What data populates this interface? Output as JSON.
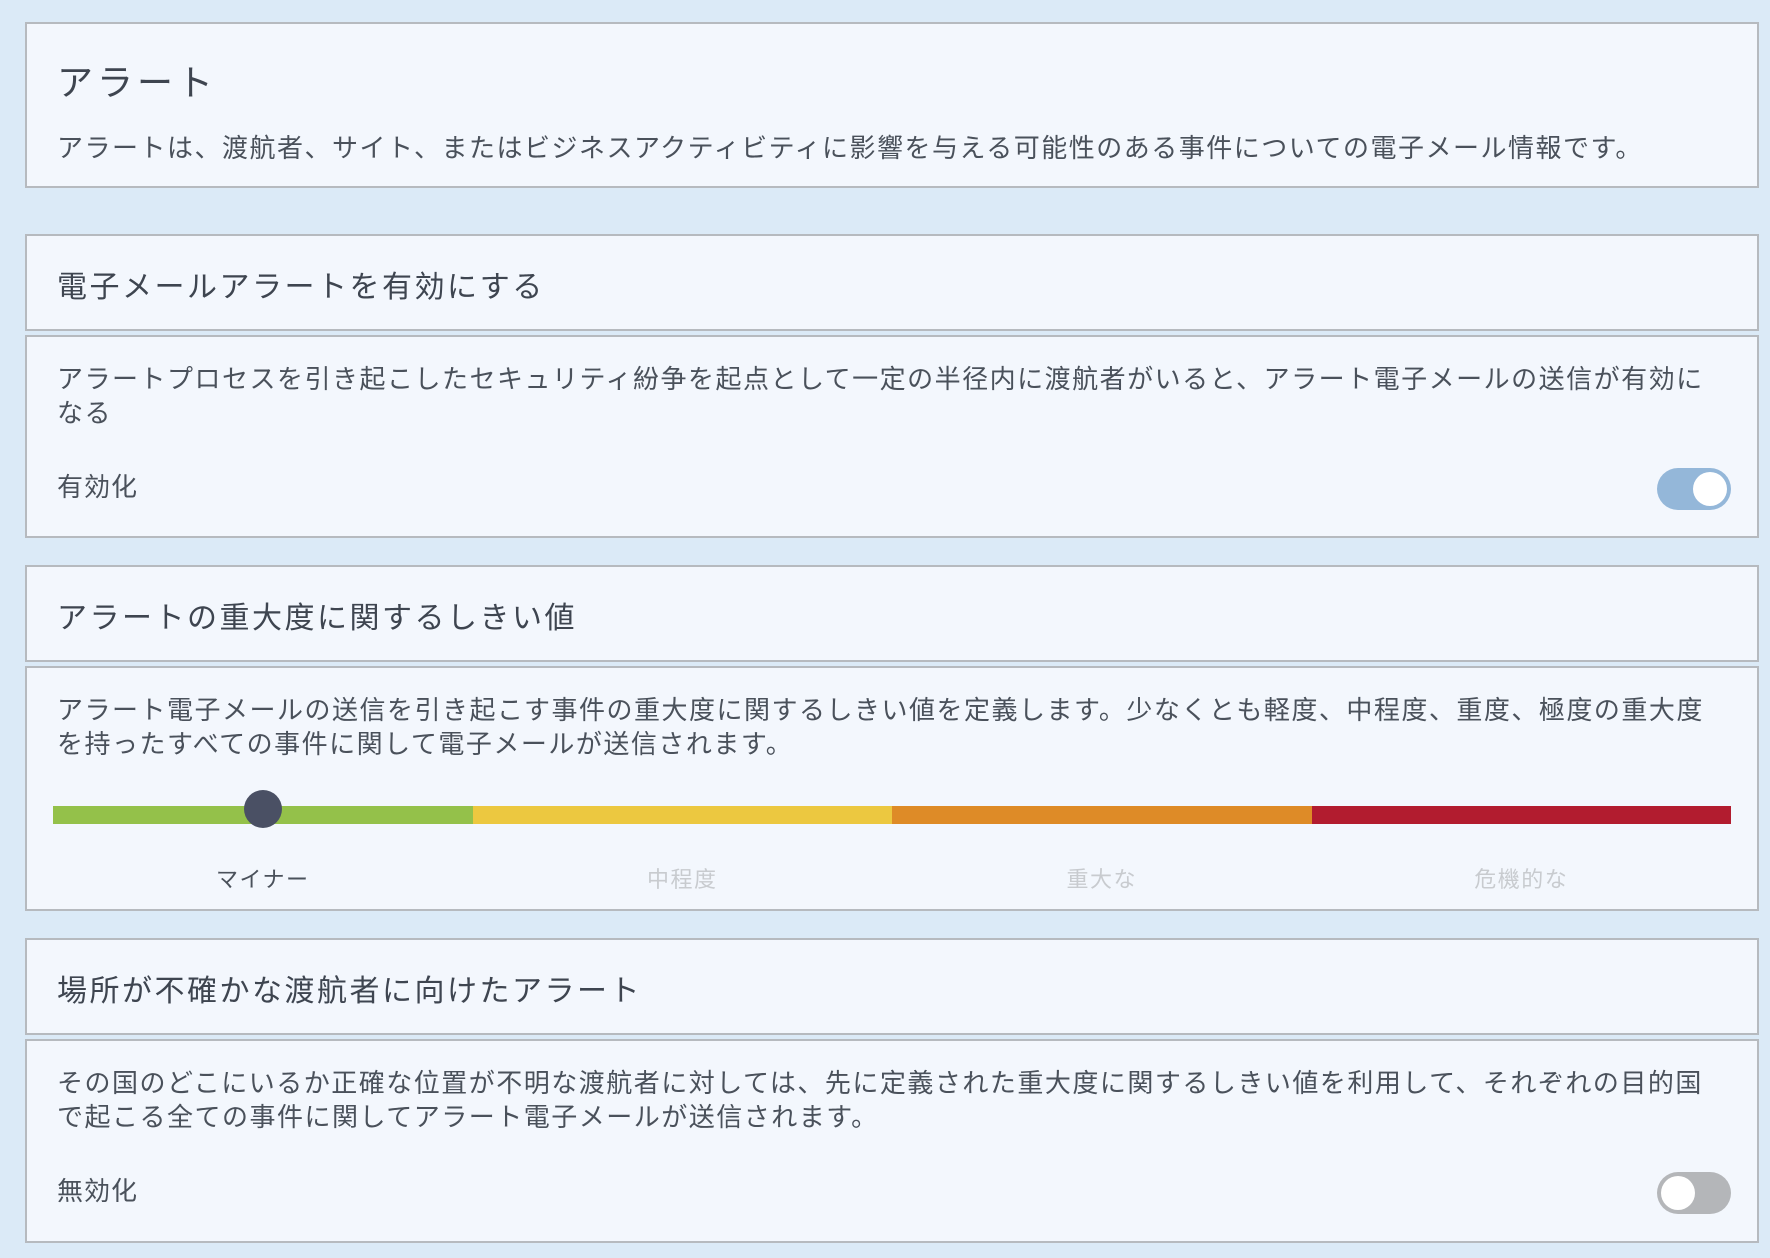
{
  "intro": {
    "title": "アラート",
    "description": "アラートは、渡航者、サイト、またはビジネスアクティビティに影響を与える可能性のある事件についての電子メール情報です。"
  },
  "email_alerts": {
    "header": "電子メールアラートを有効にする",
    "description": "アラートプロセスを引き起こしたセキュリティ紛争を起点として一定の半径内に渡航者がいると、アラート電子メールの送信が有効になる",
    "status_label": "有効化",
    "enabled": true
  },
  "severity": {
    "header": "アラートの重大度に関するしきい値",
    "description": "アラート電子メールの送信を引き起こす事件の重大度に関するしきい値を定義します。少なくとも軽度、中程度、重度、極度の重大度を持ったすべての事件に関して電子メールが送信されます。",
    "levels": [
      {
        "label": "マイナー",
        "color": "#94c14a"
      },
      {
        "label": "中程度",
        "color": "#ecc840"
      },
      {
        "label": "重大な",
        "color": "#de8b27"
      },
      {
        "label": "危機的な",
        "color": "#b21c2f"
      }
    ],
    "selected_index": 0
  },
  "uncertain_location": {
    "header": "場所が不確かな渡航者に向けたアラート",
    "description": "その国のどこにいるか正確な位置が不明な渡航者に対しては、先に定義された重大度に関するしきい値を利用して、それぞれの目的国で起こる全ての事件に関してアラート電子メールが送信されます。",
    "status_label": "無効化",
    "enabled": false
  }
}
